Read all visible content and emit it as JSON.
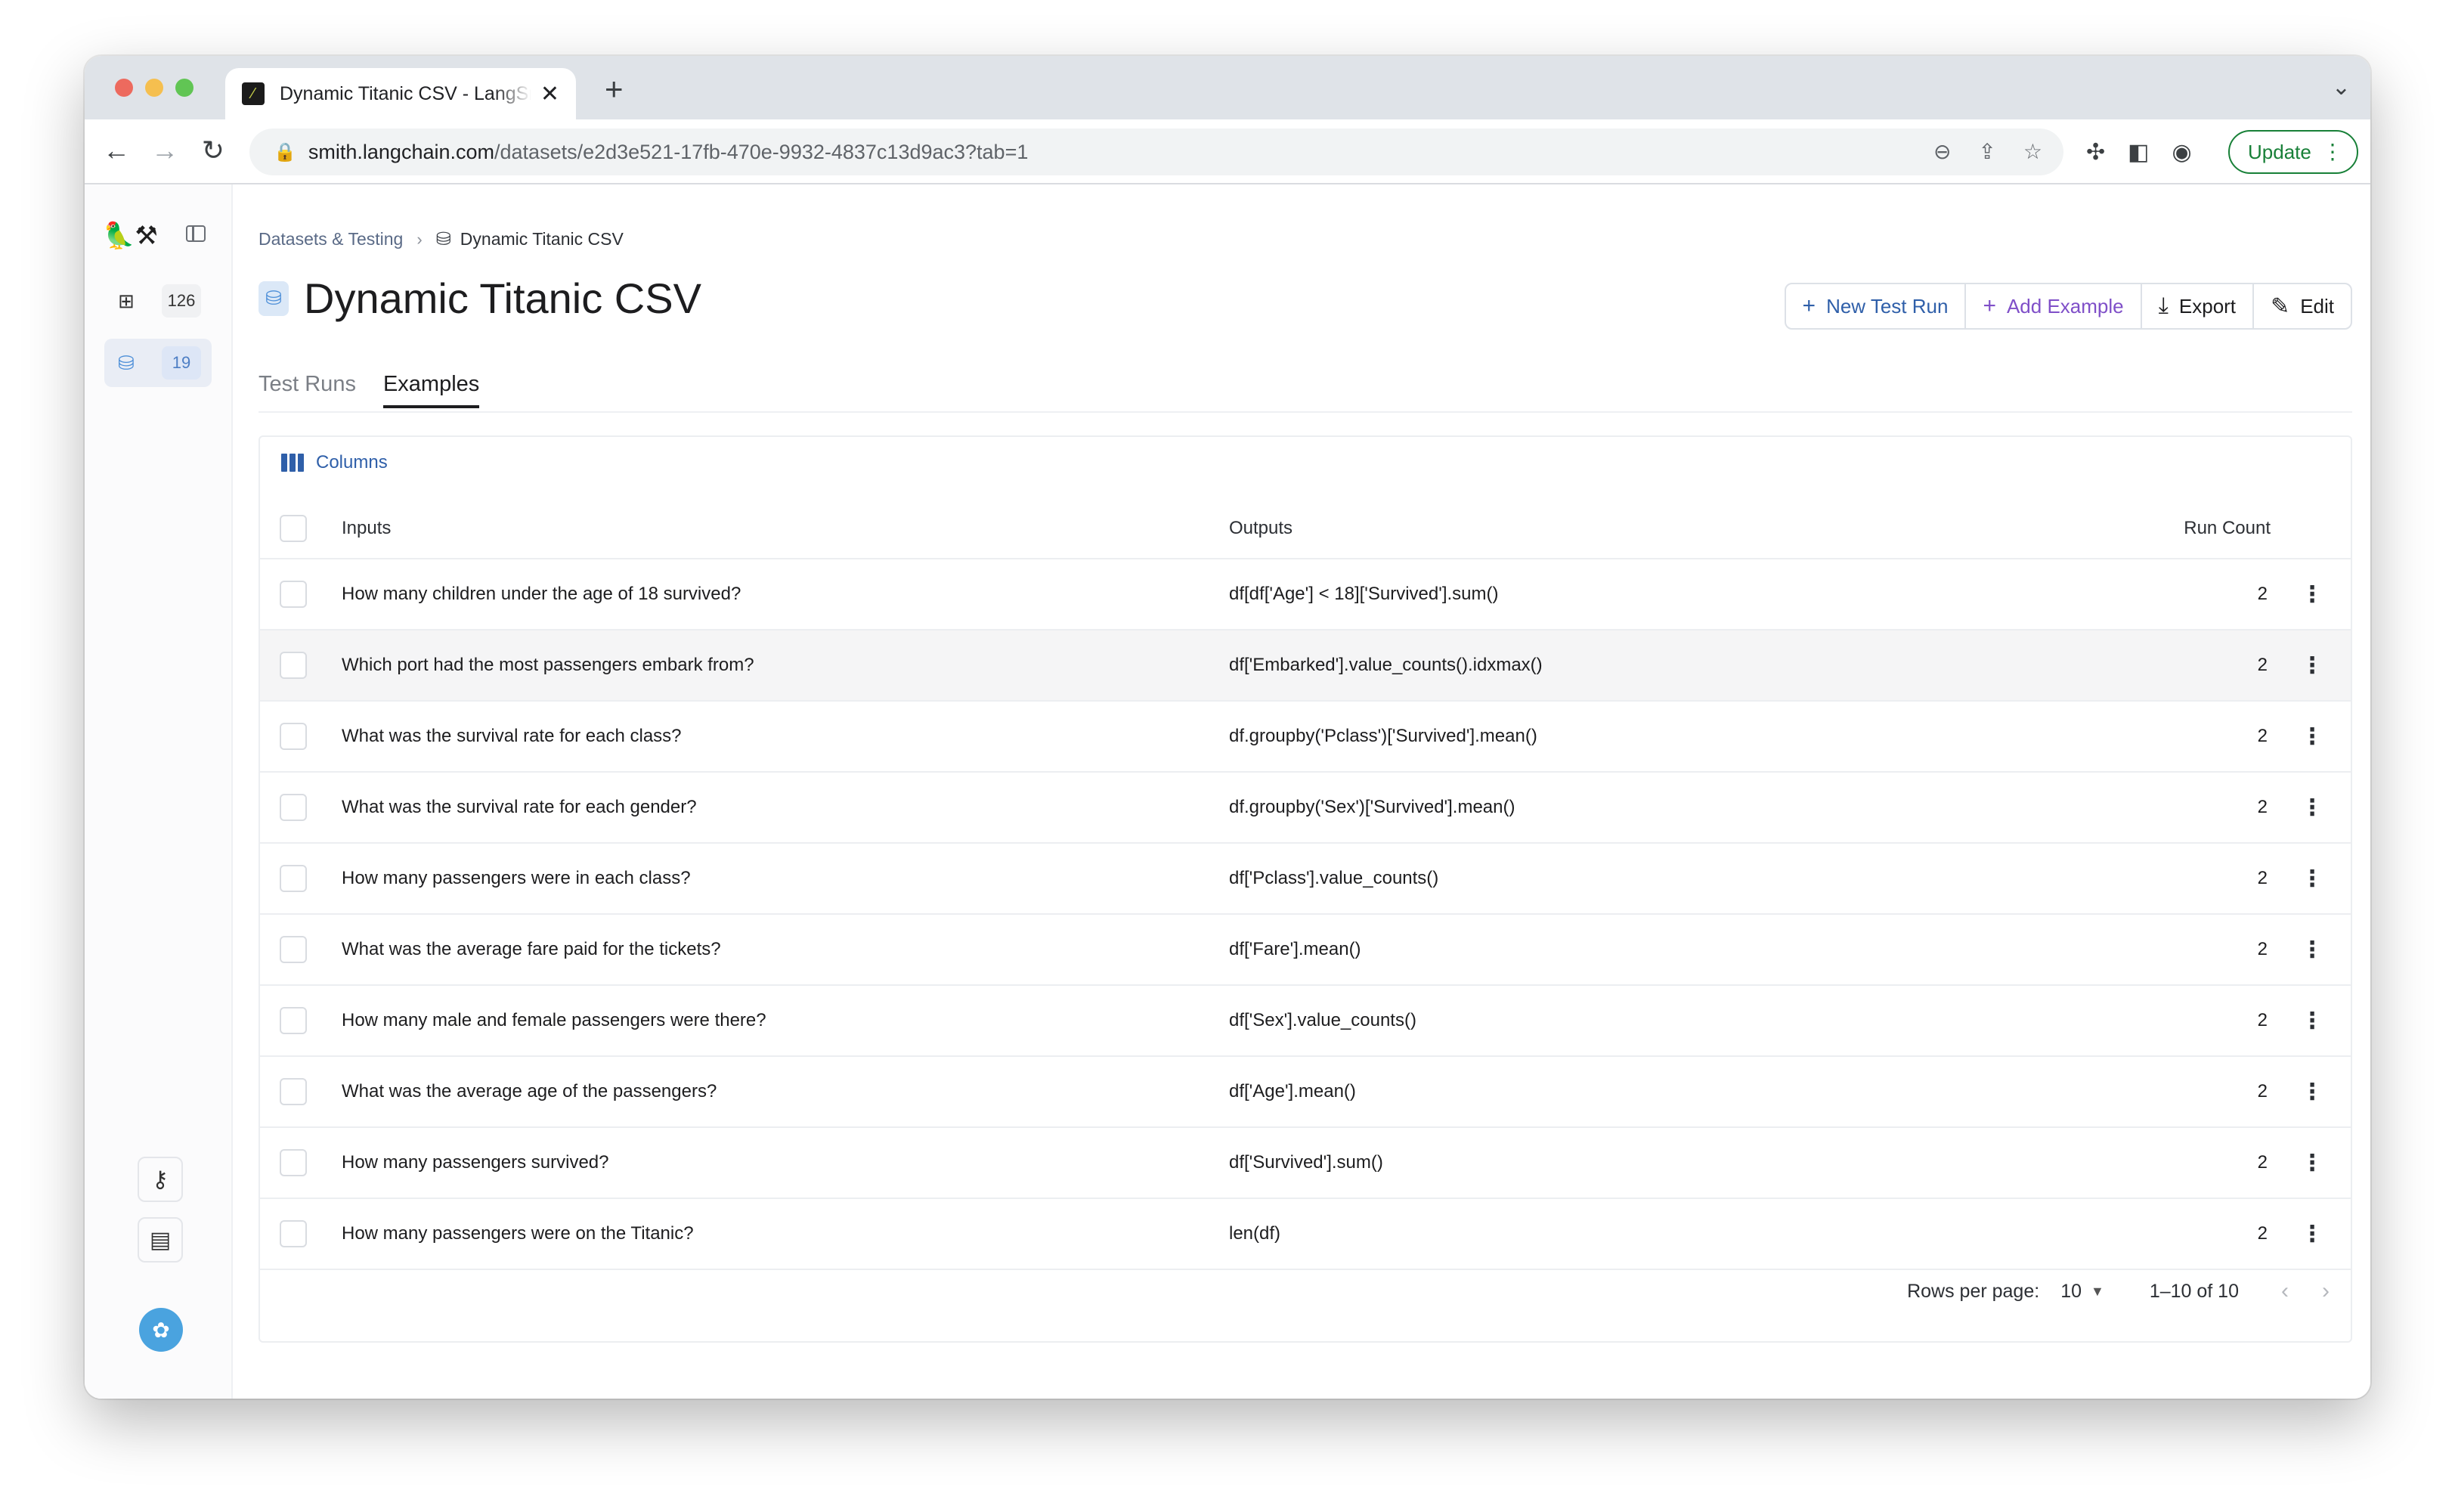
{
  "browser": {
    "tab_title": "Dynamic Titanic CSV - LangSmith",
    "url_host": "smith.langchain.com",
    "url_path": "/datasets/e2d3e521-17fb-470e-9932-4837c13d9ac3?tab=1",
    "update_label": "Update"
  },
  "sidebar": {
    "logo": "🦜⚒",
    "apps_count": "126",
    "datasets_count": "19"
  },
  "breadcrumb": {
    "parent": "Datasets & Testing",
    "current": "Dynamic Titanic CSV"
  },
  "page": {
    "title": "Dynamic Titanic CSV",
    "actions": {
      "new_test_run": "New Test Run",
      "add_example": "Add Example",
      "export": "Export",
      "edit": "Edit"
    },
    "tabs": [
      "Test Runs",
      "Examples"
    ],
    "active_tab": "Examples"
  },
  "table": {
    "columns_button": "Columns",
    "headers": {
      "inputs": "Inputs",
      "outputs": "Outputs",
      "run_count": "Run Count"
    },
    "rows": [
      {
        "input": "How many children under the age of 18 survived?",
        "output": "df[df['Age'] < 18]['Survived'].sum()",
        "runs": "2"
      },
      {
        "input": "Which port had the most passengers embark from?",
        "output": "df['Embarked'].value_counts().idxmax()",
        "runs": "2"
      },
      {
        "input": "What was the survival rate for each class?",
        "output": "df.groupby('Pclass')['Survived'].mean()",
        "runs": "2"
      },
      {
        "input": "What was the survival rate for each gender?",
        "output": "df.groupby('Sex')['Survived'].mean()",
        "runs": "2"
      },
      {
        "input": "How many passengers were in each class?",
        "output": "df['Pclass'].value_counts()",
        "runs": "2"
      },
      {
        "input": "What was the average fare paid for the tickets?",
        "output": "df['Fare'].mean()",
        "runs": "2"
      },
      {
        "input": "How many male and female passengers were there?",
        "output": "df['Sex'].value_counts()",
        "runs": "2"
      },
      {
        "input": "What was the average age of the passengers?",
        "output": "df['Age'].mean()",
        "runs": "2"
      },
      {
        "input": "How many passengers survived?",
        "output": "df['Survived'].sum()",
        "runs": "2"
      },
      {
        "input": "How many passengers were on the Titanic?",
        "output": "len(df)",
        "runs": "2"
      }
    ],
    "pagination": {
      "rows_per_page_label": "Rows per page:",
      "rows_per_page_value": "10",
      "range": "1–10 of 10"
    }
  },
  "colors": {
    "accent_blue": "#2f5fa9",
    "accent_purple": "#7f4fc8",
    "update_green": "#188038"
  }
}
